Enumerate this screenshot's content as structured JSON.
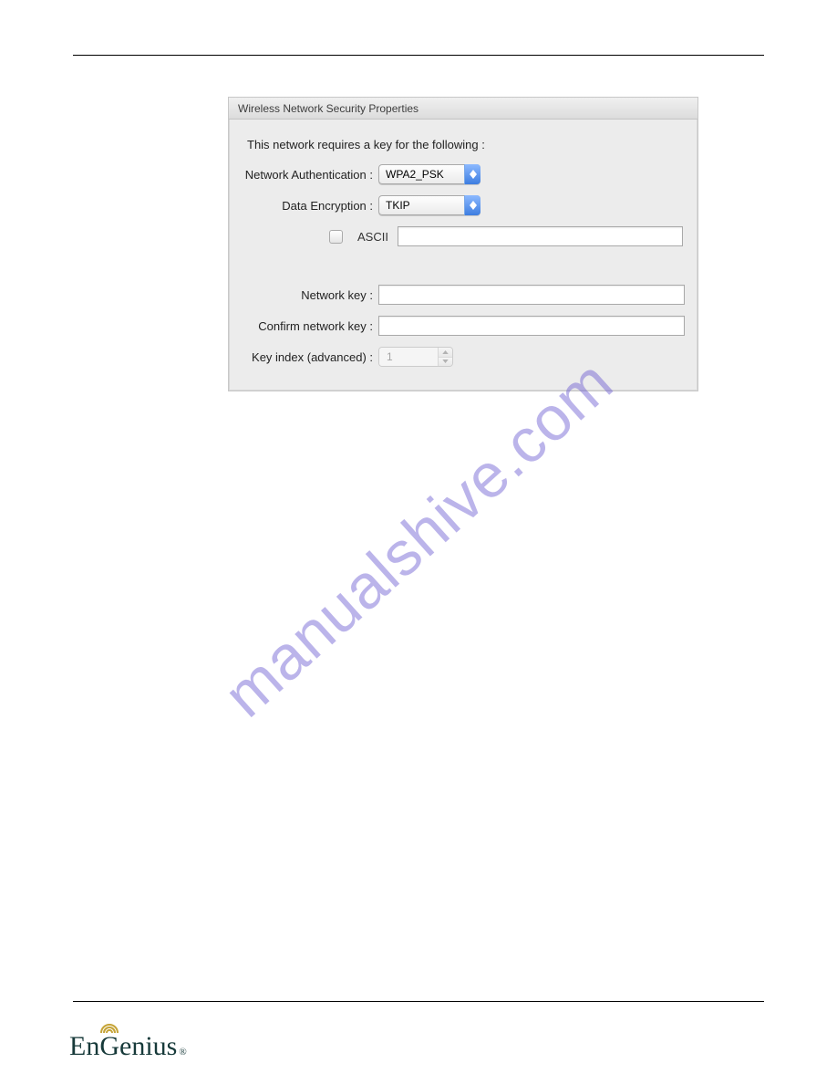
{
  "dialog": {
    "title": "Wireless Network Security Properties",
    "intro": "This network requires a key for the following :",
    "rows": {
      "auth": {
        "label": "Network Authentication :",
        "value": "WPA2_PSK"
      },
      "enc": {
        "label": "Data Encryption :",
        "value": "TKIP"
      },
      "ascii": {
        "label": "ASCII"
      },
      "netkey": {
        "label": "Network key :",
        "value": ""
      },
      "confirm": {
        "label": "Confirm network key :",
        "value": ""
      },
      "keyidx": {
        "label": "Key index (advanced) :",
        "value": "1"
      }
    }
  },
  "watermark": "manualshive.com",
  "logo": {
    "text_left": "En",
    "text_g": "G",
    "text_right": "enius",
    "reg": "®"
  }
}
